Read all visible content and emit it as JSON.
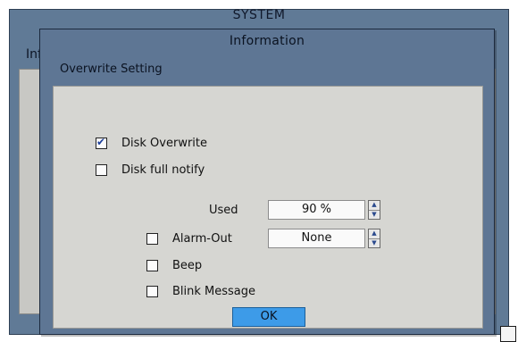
{
  "background_window": {
    "title": "SYSTEM",
    "tab_label": "Inf"
  },
  "dialog": {
    "title": "Information",
    "subtitle": "Overwrite Setting",
    "ok_label": "OK"
  },
  "options": {
    "disk_overwrite": {
      "label": "Disk Overwrite",
      "checked": true
    },
    "disk_full_notify": {
      "label": "Disk full notify",
      "checked": false
    }
  },
  "fields": {
    "used": {
      "label": "Used",
      "value": "90 %"
    },
    "alarm_out": {
      "label": "Alarm-Out",
      "value": "None",
      "checked": false
    }
  },
  "notify_actions": {
    "beep": {
      "label": "Beep",
      "checked": false
    },
    "blink_message": {
      "label": "Blink Message",
      "checked": false
    }
  },
  "colors": {
    "dialog_frame": "#5e7694",
    "panel": "#d6d6d2",
    "ok_button": "#3d9be8",
    "check_mark": "#1d3f9a"
  }
}
